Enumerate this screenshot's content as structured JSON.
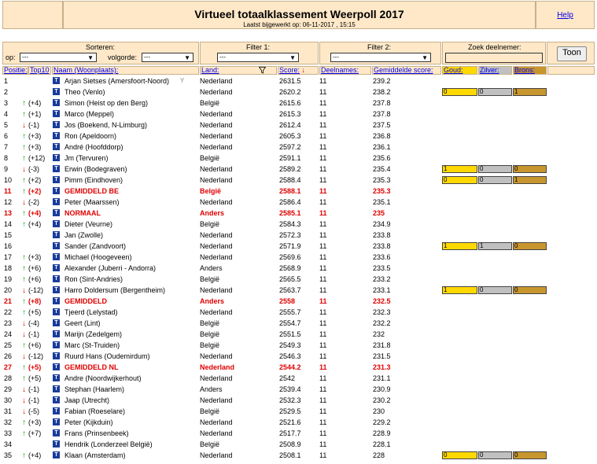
{
  "header": {
    "title": "Virtueel totaalklassement Weerpoll 2017",
    "subtitle": "Laatst bijgewerkt op: 06-11-2017 , 15:15",
    "help": "Help"
  },
  "controls": {
    "sort_label": "Sorteren:",
    "op_label": "op:",
    "order_label": "volgorde:",
    "op_value": "---",
    "order_value": "---",
    "filter1_label": "Filter 1:",
    "filter1_value": "---",
    "filter2_label": "Filter 2:",
    "filter2_value": "---",
    "search_label": "Zoek deelnemer:",
    "search_value": "",
    "toon": "Toon"
  },
  "columns": {
    "positie": "Positie:",
    "top10": "Top10",
    "naam": "Naam (Woonplaats):",
    "land": "Land:",
    "score": "Score:",
    "score_arrow": "↓",
    "deelnames": "Deelnames:",
    "gemiddelde": "Gemiddelde score:",
    "goud": "Goud:",
    "zilver": "Zilver:",
    "brons": "Brons:"
  },
  "icons": {
    "rank_up": "arrow-up-icon",
    "rank_down": "arrow-down-icon",
    "profile": "profile-icon",
    "filter": "funnel-icon",
    "trophy": "trophy-icon"
  },
  "colors": {
    "header_bg": "#ffe8c8",
    "gold": "#ffd800",
    "silver": "#c0c0c0",
    "bronze": "#c8962e",
    "highlight": "#e00000",
    "up": "#12a012"
  },
  "chart_data": {
    "type": "table",
    "columns": [
      "Positie",
      "Top10",
      "Naam (Woonplaats)",
      "Land",
      "Score",
      "Deelnames",
      "Gemiddelde score",
      "Goud",
      "Zilver",
      "Brons"
    ],
    "rows": [
      {
        "pos": "1",
        "dir": "",
        "chg": "",
        "name": "Arjan Sietses (Amersfoort-Noord)",
        "land": "Nederland",
        "score": "2631.5",
        "deel": "11",
        "gem": "239.2",
        "trophy": true
      },
      {
        "pos": "2",
        "dir": "",
        "chg": "",
        "name": "Theo (Venlo)",
        "land": "Nederland",
        "score": "2620.2",
        "deel": "11",
        "gem": "238.2",
        "medals": [
          "0",
          "0",
          "1"
        ]
      },
      {
        "pos": "3",
        "dir": "up",
        "chg": "(+4)",
        "name": "Simon (Heist op den Berg)",
        "land": "België",
        "score": "2615.6",
        "deel": "11",
        "gem": "237.8"
      },
      {
        "pos": "4",
        "dir": "up",
        "chg": "(+1)",
        "name": "Marco (Meppel)",
        "land": "Nederland",
        "score": "2615.3",
        "deel": "11",
        "gem": "237.8"
      },
      {
        "pos": "5",
        "dir": "down",
        "chg": "(-1)",
        "name": "Jos (Boekend, N-Limburg)",
        "land": "Nederland",
        "score": "2612.4",
        "deel": "11",
        "gem": "237.5"
      },
      {
        "pos": "6",
        "dir": "up",
        "chg": "(+3)",
        "name": "Ron (Apeldoorn)",
        "land": "Nederland",
        "score": "2605.3",
        "deel": "11",
        "gem": "236.8"
      },
      {
        "pos": "7",
        "dir": "up",
        "chg": "(+3)",
        "name": "André (Hoofddorp)",
        "land": "Nederland",
        "score": "2597.2",
        "deel": "11",
        "gem": "236.1"
      },
      {
        "pos": "8",
        "dir": "up",
        "chg": "(+12)",
        "name": "Jm (Tervuren)",
        "land": "België",
        "score": "2591.1",
        "deel": "11",
        "gem": "235.6"
      },
      {
        "pos": "9",
        "dir": "down",
        "chg": "(-3)",
        "name": "Erwin (Bodegraven)",
        "land": "Nederland",
        "score": "2589.2",
        "deel": "11",
        "gem": "235.4",
        "medals": [
          "1",
          "0",
          "0"
        ]
      },
      {
        "pos": "10",
        "dir": "up",
        "chg": "(+2)",
        "name": "Pimm (Eindhoven)",
        "land": "Nederland",
        "score": "2588.4",
        "deel": "11",
        "gem": "235.3",
        "medals": [
          "0",
          "0",
          "1"
        ]
      },
      {
        "pos": "11",
        "dir": "up",
        "chg": "(+2)",
        "name": "GEMIDDELD BE",
        "land": "België",
        "score": "2588.1",
        "deel": "11",
        "gem": "235.3",
        "red": true
      },
      {
        "pos": "12",
        "dir": "down",
        "chg": "(-2)",
        "name": "Peter (Maarssen)",
        "land": "Nederland",
        "score": "2586.4",
        "deel": "11",
        "gem": "235.1"
      },
      {
        "pos": "13",
        "dir": "up",
        "chg": "(+4)",
        "name": "NORMAAL",
        "land": "Anders",
        "score": "2585.1",
        "deel": "11",
        "gem": "235",
        "red": true
      },
      {
        "pos": "14",
        "dir": "up",
        "chg": "(+4)",
        "name": "Dieter (Veurne)",
        "land": "België",
        "score": "2584.3",
        "deel": "11",
        "gem": "234.9"
      },
      {
        "pos": "15",
        "dir": "",
        "chg": "",
        "name": "Jan (Zwolle)",
        "land": "Nederland",
        "score": "2572.3",
        "deel": "11",
        "gem": "233.8"
      },
      {
        "pos": "16",
        "dir": "",
        "chg": "",
        "name": "Sander (Zandvoort)",
        "land": "Nederland",
        "score": "2571.9",
        "deel": "11",
        "gem": "233.8",
        "medals": [
          "1",
          "1",
          "0"
        ]
      },
      {
        "pos": "17",
        "dir": "up",
        "chg": "(+3)",
        "name": "Michael (Hoogeveen)",
        "land": "Nederland",
        "score": "2569.6",
        "deel": "11",
        "gem": "233.6"
      },
      {
        "pos": "18",
        "dir": "up",
        "chg": "(+6)",
        "name": "Alexander (Juberri - Andorra)",
        "land": "Anders",
        "score": "2568.9",
        "deel": "11",
        "gem": "233.5"
      },
      {
        "pos": "19",
        "dir": "up",
        "chg": "(+6)",
        "name": "Ron (Sint-Andries)",
        "land": "België",
        "score": "2565.5",
        "deel": "11",
        "gem": "233.2"
      },
      {
        "pos": "20",
        "dir": "down",
        "chg": "(-12)",
        "name": "Harro Doldersum (Bergentheim)",
        "land": "Nederland",
        "score": "2563.7",
        "deel": "11",
        "gem": "233.1",
        "medals": [
          "1",
          "0",
          "0"
        ]
      },
      {
        "pos": "21",
        "dir": "up",
        "chg": "(+8)",
        "name": "GEMIDDELD",
        "land": "Anders",
        "score": "2558",
        "deel": "11",
        "gem": "232.5",
        "red": true
      },
      {
        "pos": "22",
        "dir": "up",
        "chg": "(+5)",
        "name": "Tjeerd (Lelystad)",
        "land": "Nederland",
        "score": "2555.7",
        "deel": "11",
        "gem": "232.3"
      },
      {
        "pos": "23",
        "dir": "down",
        "chg": "(-4)",
        "name": "Geert (Lint)",
        "land": "België",
        "score": "2554.7",
        "deel": "11",
        "gem": "232.2"
      },
      {
        "pos": "24",
        "dir": "down",
        "chg": "(-1)",
        "name": "Marijn (Zedelgem)",
        "land": "België",
        "score": "2551.5",
        "deel": "11",
        "gem": "232"
      },
      {
        "pos": "25",
        "dir": "up",
        "chg": "(+6)",
        "name": "Marc (St-Truiden)",
        "land": "België",
        "score": "2549.3",
        "deel": "11",
        "gem": "231.8"
      },
      {
        "pos": "26",
        "dir": "down",
        "chg": "(-12)",
        "name": "Ruurd Hans (Oudemirdum)",
        "land": "Nederland",
        "score": "2546.3",
        "deel": "11",
        "gem": "231.5"
      },
      {
        "pos": "27",
        "dir": "up",
        "chg": "(+5)",
        "name": "GEMIDDELD NL",
        "land": "Nederland",
        "score": "2544.2",
        "deel": "11",
        "gem": "231.3",
        "red": true
      },
      {
        "pos": "28",
        "dir": "up",
        "chg": "(+5)",
        "name": "Andre (Noordwijkerhout)",
        "land": "Nederland",
        "score": "2542",
        "deel": "11",
        "gem": "231.1"
      },
      {
        "pos": "29",
        "dir": "down",
        "chg": "(-1)",
        "name": "Stephan (Haarlem)",
        "land": "Anders",
        "score": "2539.4",
        "deel": "11",
        "gem": "230.9"
      },
      {
        "pos": "30",
        "dir": "down",
        "chg": "(-1)",
        "name": "Jaap (Utrecht)",
        "land": "Nederland",
        "score": "2532.3",
        "deel": "11",
        "gem": "230.2"
      },
      {
        "pos": "31",
        "dir": "down",
        "chg": "(-5)",
        "name": "Fabian (Roeselare)",
        "land": "België",
        "score": "2529.5",
        "deel": "11",
        "gem": "230"
      },
      {
        "pos": "32",
        "dir": "up",
        "chg": "(+3)",
        "name": "Peter (Kijkduin)",
        "land": "Nederland",
        "score": "2521.6",
        "deel": "11",
        "gem": "229.2"
      },
      {
        "pos": "33",
        "dir": "up",
        "chg": "(+7)",
        "name": "Frans (Prinsenbeek)",
        "land": "Nederland",
        "score": "2517.7",
        "deel": "11",
        "gem": "228.9"
      },
      {
        "pos": "34",
        "dir": "",
        "chg": "",
        "name": "Hendrik (Londerzeel België)",
        "land": "België",
        "score": "2508.9",
        "deel": "11",
        "gem": "228.1"
      },
      {
        "pos": "35",
        "dir": "up",
        "chg": "(+4)",
        "name": "Klaan (Amsterdam)",
        "land": "Nederland",
        "score": "2508.1",
        "deel": "11",
        "gem": "228",
        "medals": [
          "0",
          "0",
          "0"
        ]
      }
    ]
  }
}
